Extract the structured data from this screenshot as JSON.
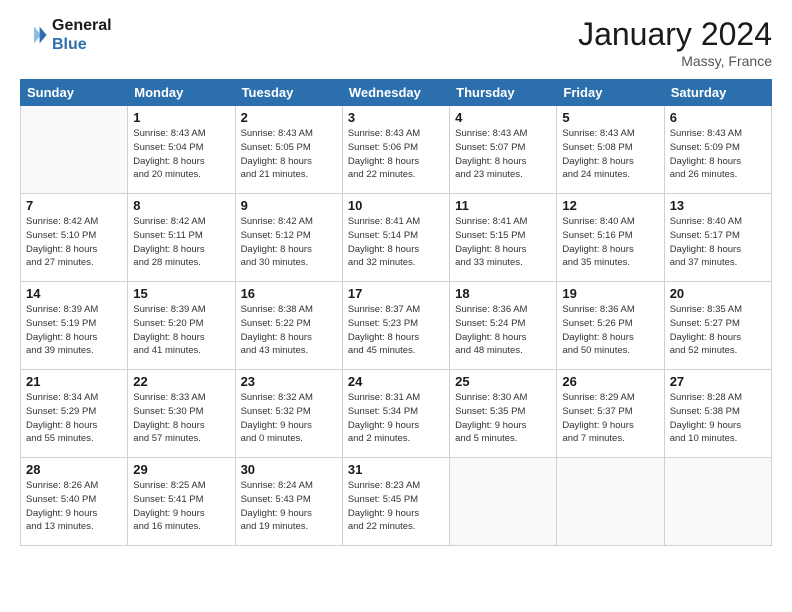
{
  "header": {
    "logo_line1": "General",
    "logo_line2": "Blue",
    "month_title": "January 2024",
    "location": "Massy, France"
  },
  "days_of_week": [
    "Sunday",
    "Monday",
    "Tuesday",
    "Wednesday",
    "Thursday",
    "Friday",
    "Saturday"
  ],
  "weeks": [
    [
      {
        "day": "",
        "info": ""
      },
      {
        "day": "1",
        "info": "Sunrise: 8:43 AM\nSunset: 5:04 PM\nDaylight: 8 hours\nand 20 minutes."
      },
      {
        "day": "2",
        "info": "Sunrise: 8:43 AM\nSunset: 5:05 PM\nDaylight: 8 hours\nand 21 minutes."
      },
      {
        "day": "3",
        "info": "Sunrise: 8:43 AM\nSunset: 5:06 PM\nDaylight: 8 hours\nand 22 minutes."
      },
      {
        "day": "4",
        "info": "Sunrise: 8:43 AM\nSunset: 5:07 PM\nDaylight: 8 hours\nand 23 minutes."
      },
      {
        "day": "5",
        "info": "Sunrise: 8:43 AM\nSunset: 5:08 PM\nDaylight: 8 hours\nand 24 minutes."
      },
      {
        "day": "6",
        "info": "Sunrise: 8:43 AM\nSunset: 5:09 PM\nDaylight: 8 hours\nand 26 minutes."
      }
    ],
    [
      {
        "day": "7",
        "info": "Sunrise: 8:42 AM\nSunset: 5:10 PM\nDaylight: 8 hours\nand 27 minutes."
      },
      {
        "day": "8",
        "info": "Sunrise: 8:42 AM\nSunset: 5:11 PM\nDaylight: 8 hours\nand 28 minutes."
      },
      {
        "day": "9",
        "info": "Sunrise: 8:42 AM\nSunset: 5:12 PM\nDaylight: 8 hours\nand 30 minutes."
      },
      {
        "day": "10",
        "info": "Sunrise: 8:41 AM\nSunset: 5:14 PM\nDaylight: 8 hours\nand 32 minutes."
      },
      {
        "day": "11",
        "info": "Sunrise: 8:41 AM\nSunset: 5:15 PM\nDaylight: 8 hours\nand 33 minutes."
      },
      {
        "day": "12",
        "info": "Sunrise: 8:40 AM\nSunset: 5:16 PM\nDaylight: 8 hours\nand 35 minutes."
      },
      {
        "day": "13",
        "info": "Sunrise: 8:40 AM\nSunset: 5:17 PM\nDaylight: 8 hours\nand 37 minutes."
      }
    ],
    [
      {
        "day": "14",
        "info": "Sunrise: 8:39 AM\nSunset: 5:19 PM\nDaylight: 8 hours\nand 39 minutes."
      },
      {
        "day": "15",
        "info": "Sunrise: 8:39 AM\nSunset: 5:20 PM\nDaylight: 8 hours\nand 41 minutes."
      },
      {
        "day": "16",
        "info": "Sunrise: 8:38 AM\nSunset: 5:22 PM\nDaylight: 8 hours\nand 43 minutes."
      },
      {
        "day": "17",
        "info": "Sunrise: 8:37 AM\nSunset: 5:23 PM\nDaylight: 8 hours\nand 45 minutes."
      },
      {
        "day": "18",
        "info": "Sunrise: 8:36 AM\nSunset: 5:24 PM\nDaylight: 8 hours\nand 48 minutes."
      },
      {
        "day": "19",
        "info": "Sunrise: 8:36 AM\nSunset: 5:26 PM\nDaylight: 8 hours\nand 50 minutes."
      },
      {
        "day": "20",
        "info": "Sunrise: 8:35 AM\nSunset: 5:27 PM\nDaylight: 8 hours\nand 52 minutes."
      }
    ],
    [
      {
        "day": "21",
        "info": "Sunrise: 8:34 AM\nSunset: 5:29 PM\nDaylight: 8 hours\nand 55 minutes."
      },
      {
        "day": "22",
        "info": "Sunrise: 8:33 AM\nSunset: 5:30 PM\nDaylight: 8 hours\nand 57 minutes."
      },
      {
        "day": "23",
        "info": "Sunrise: 8:32 AM\nSunset: 5:32 PM\nDaylight: 9 hours\nand 0 minutes."
      },
      {
        "day": "24",
        "info": "Sunrise: 8:31 AM\nSunset: 5:34 PM\nDaylight: 9 hours\nand 2 minutes."
      },
      {
        "day": "25",
        "info": "Sunrise: 8:30 AM\nSunset: 5:35 PM\nDaylight: 9 hours\nand 5 minutes."
      },
      {
        "day": "26",
        "info": "Sunrise: 8:29 AM\nSunset: 5:37 PM\nDaylight: 9 hours\nand 7 minutes."
      },
      {
        "day": "27",
        "info": "Sunrise: 8:28 AM\nSunset: 5:38 PM\nDaylight: 9 hours\nand 10 minutes."
      }
    ],
    [
      {
        "day": "28",
        "info": "Sunrise: 8:26 AM\nSunset: 5:40 PM\nDaylight: 9 hours\nand 13 minutes."
      },
      {
        "day": "29",
        "info": "Sunrise: 8:25 AM\nSunset: 5:41 PM\nDaylight: 9 hours\nand 16 minutes."
      },
      {
        "day": "30",
        "info": "Sunrise: 8:24 AM\nSunset: 5:43 PM\nDaylight: 9 hours\nand 19 minutes."
      },
      {
        "day": "31",
        "info": "Sunrise: 8:23 AM\nSunset: 5:45 PM\nDaylight: 9 hours\nand 22 minutes."
      },
      {
        "day": "",
        "info": ""
      },
      {
        "day": "",
        "info": ""
      },
      {
        "day": "",
        "info": ""
      }
    ]
  ]
}
